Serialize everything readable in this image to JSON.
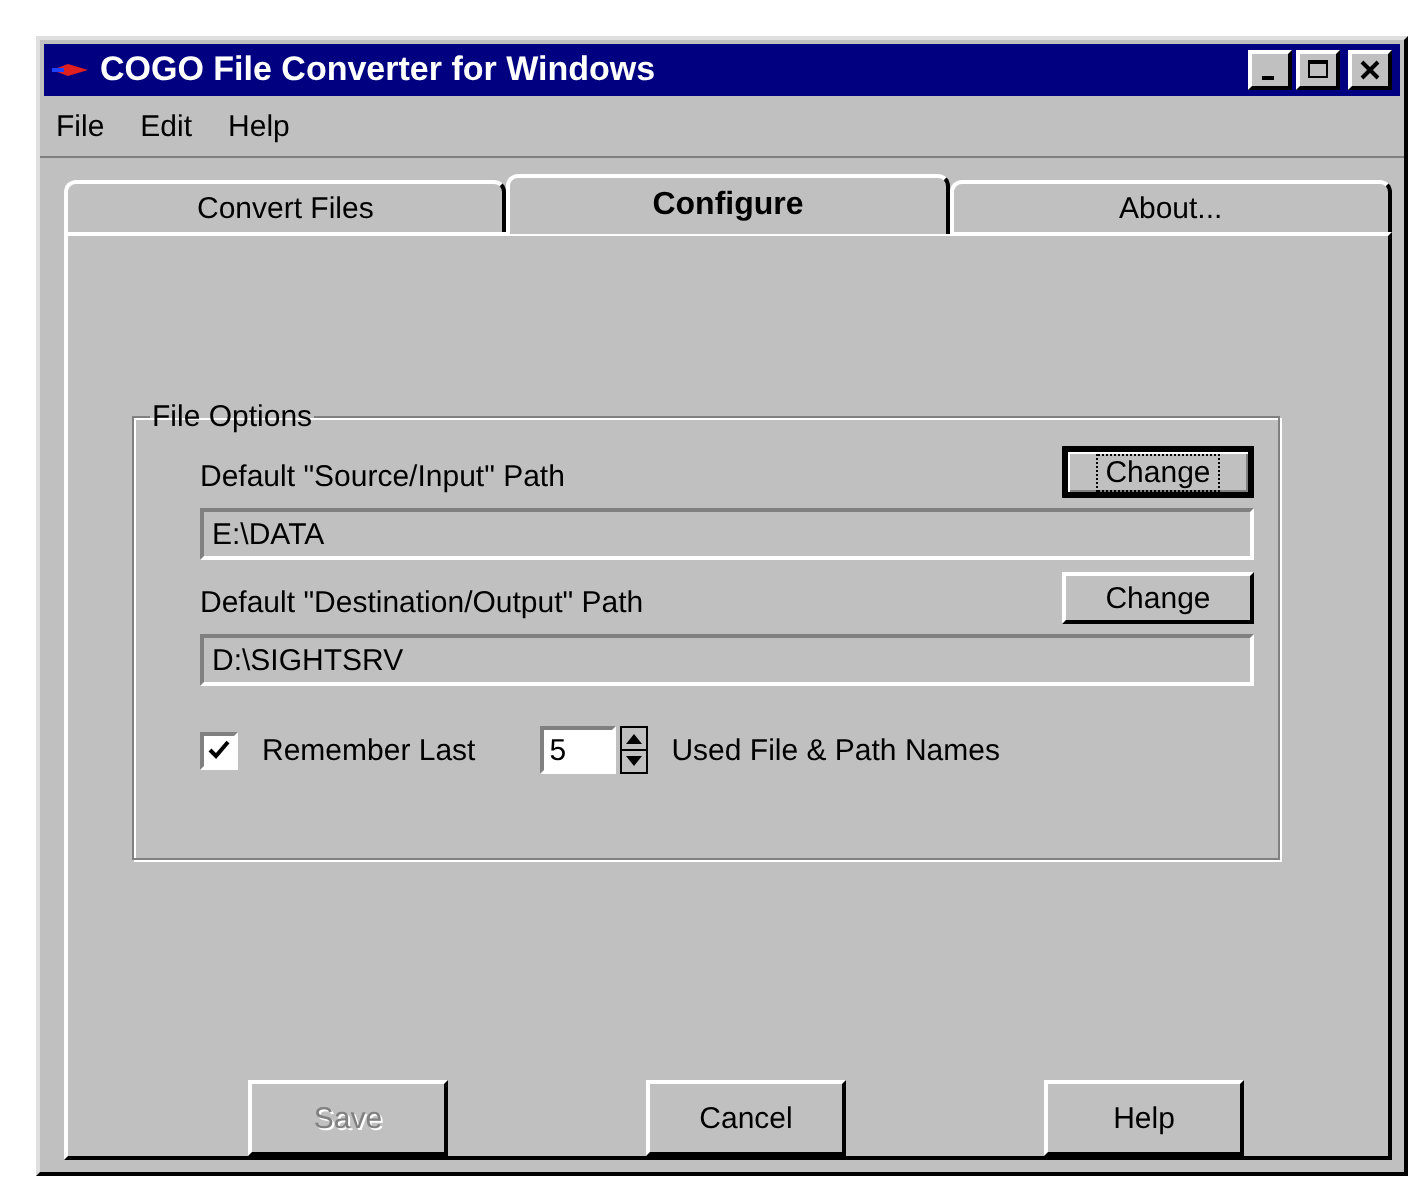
{
  "window": {
    "title": "COGO File Converter for Windows"
  },
  "menu": [
    "File",
    "Edit",
    "Help"
  ],
  "tabs": [
    {
      "label": "Convert Files",
      "selected": false
    },
    {
      "label": "Configure",
      "selected": true
    },
    {
      "label": "About...",
      "selected": false
    }
  ],
  "file_options": {
    "title": "File Options",
    "paths": [
      {
        "label": "Default  \"Source/Input\" Path",
        "button": "Change",
        "focused": true,
        "value": "E:\\DATA"
      },
      {
        "label": "Default  \"Destination/Output\"  Path",
        "button": "Change",
        "focused": false,
        "value": "D:\\SIGHTSRV"
      }
    ],
    "remember": {
      "label": "Remember Last",
      "checked": true,
      "count": "5",
      "suffix": "Used File & Path Names"
    }
  },
  "buttons": [
    {
      "label": "Save",
      "disabled": true
    },
    {
      "label": "Cancel",
      "disabled": false
    },
    {
      "label": "Help",
      "disabled": false
    }
  ]
}
